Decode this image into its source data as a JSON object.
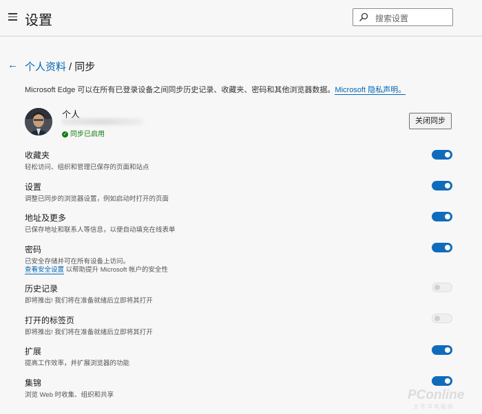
{
  "header": {
    "title": "设置",
    "search_placeholder": "搜索设置"
  },
  "breadcrumb": {
    "parent": "个人资料",
    "separator": "/",
    "current": "同步"
  },
  "description": {
    "text": "Microsoft Edge 可以在所有已登录设备之间同步历史记录、收藏夹、密码和其他浏览器数据。",
    "link": "Microsoft 隐私声明。"
  },
  "profile": {
    "name": "个人",
    "sync_status": "同步已启用",
    "turn_off_label": "关闭同步"
  },
  "items": [
    {
      "title": "收藏夹",
      "desc": "轻松访问、组织和管理已保存的页面和站点",
      "state": "on"
    },
    {
      "title": "设置",
      "desc": "调整已同步的浏览器设置，例如启动时打开的页面",
      "state": "on"
    },
    {
      "title": "地址及更多",
      "desc": "已保存地址和联系人等信息，以便自动填充在线表单",
      "state": "on"
    },
    {
      "title": "密码",
      "desc": "已安全存储并可在所有设备上访问。",
      "desc_link": "查看安全设置",
      "desc_after": "以帮助提升 Microsoft 帐户的安全性",
      "state": "on"
    },
    {
      "title": "历史记录",
      "desc": "即将推出! 我们将在准备就绪后立即将其打开",
      "state": "disabled"
    },
    {
      "title": "打开的标签页",
      "desc": "即将推出! 我们将在准备就绪后立即将其打开",
      "state": "disabled"
    },
    {
      "title": "扩展",
      "desc": "提高工作效率，并扩展浏览器的功能",
      "state": "on"
    },
    {
      "title": "集锦",
      "desc": "浏览 Web 时收集、组织和共享",
      "state": "on"
    }
  ],
  "watermark": {
    "brand": "PConline",
    "sub": "太平洋电脑网"
  },
  "colors": {
    "accent": "#0f6cbd",
    "link": "#0066b4",
    "success": "#107c10"
  }
}
